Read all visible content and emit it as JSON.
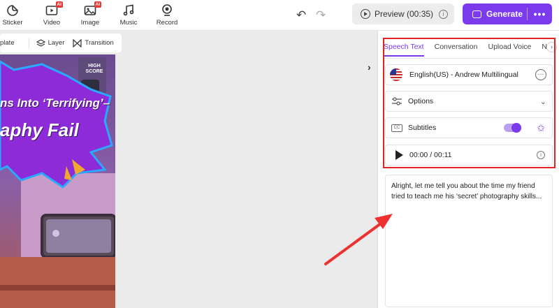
{
  "toolbar": {
    "tools": [
      {
        "label": "Sticker",
        "icon": "sticker-icon",
        "ai": false
      },
      {
        "label": "Video",
        "icon": "video-icon",
        "ai": true
      },
      {
        "label": "Image",
        "icon": "image-icon",
        "ai": true
      },
      {
        "label": "Music",
        "icon": "music-icon",
        "ai": false
      },
      {
        "label": "Record",
        "icon": "record-icon",
        "ai": false
      }
    ],
    "ai_badge": "AI",
    "preview_label": "Preview (00:35)",
    "generate_label": "Generate",
    "more_label": "•••"
  },
  "canvas_toolbar": {
    "template_label": "plate",
    "layer_label": "Layer",
    "transition_label": "Transition"
  },
  "video": {
    "title_line1": "ns Into ‘Terrifying’–",
    "title_line2": "aphy Fail",
    "high_score": "HIGH SCORE"
  },
  "panel": {
    "tabs": [
      "Speech Text",
      "Conversation",
      "Upload Voice",
      "No"
    ],
    "active_tab": 0,
    "voice_label": "English(US) - Andrew Multilingual",
    "options_label": "Options",
    "subtitles_label": "Subtitles",
    "subtitles_on": true,
    "cc_label": "CC",
    "time_label": "00:00 / 00:11",
    "speech_text": "Alright, let me tell you about the time my friend tried to teach me his ‘secret’ photography skills..."
  },
  "colors": {
    "accent": "#7c3aed",
    "highlight": "#e02424"
  }
}
